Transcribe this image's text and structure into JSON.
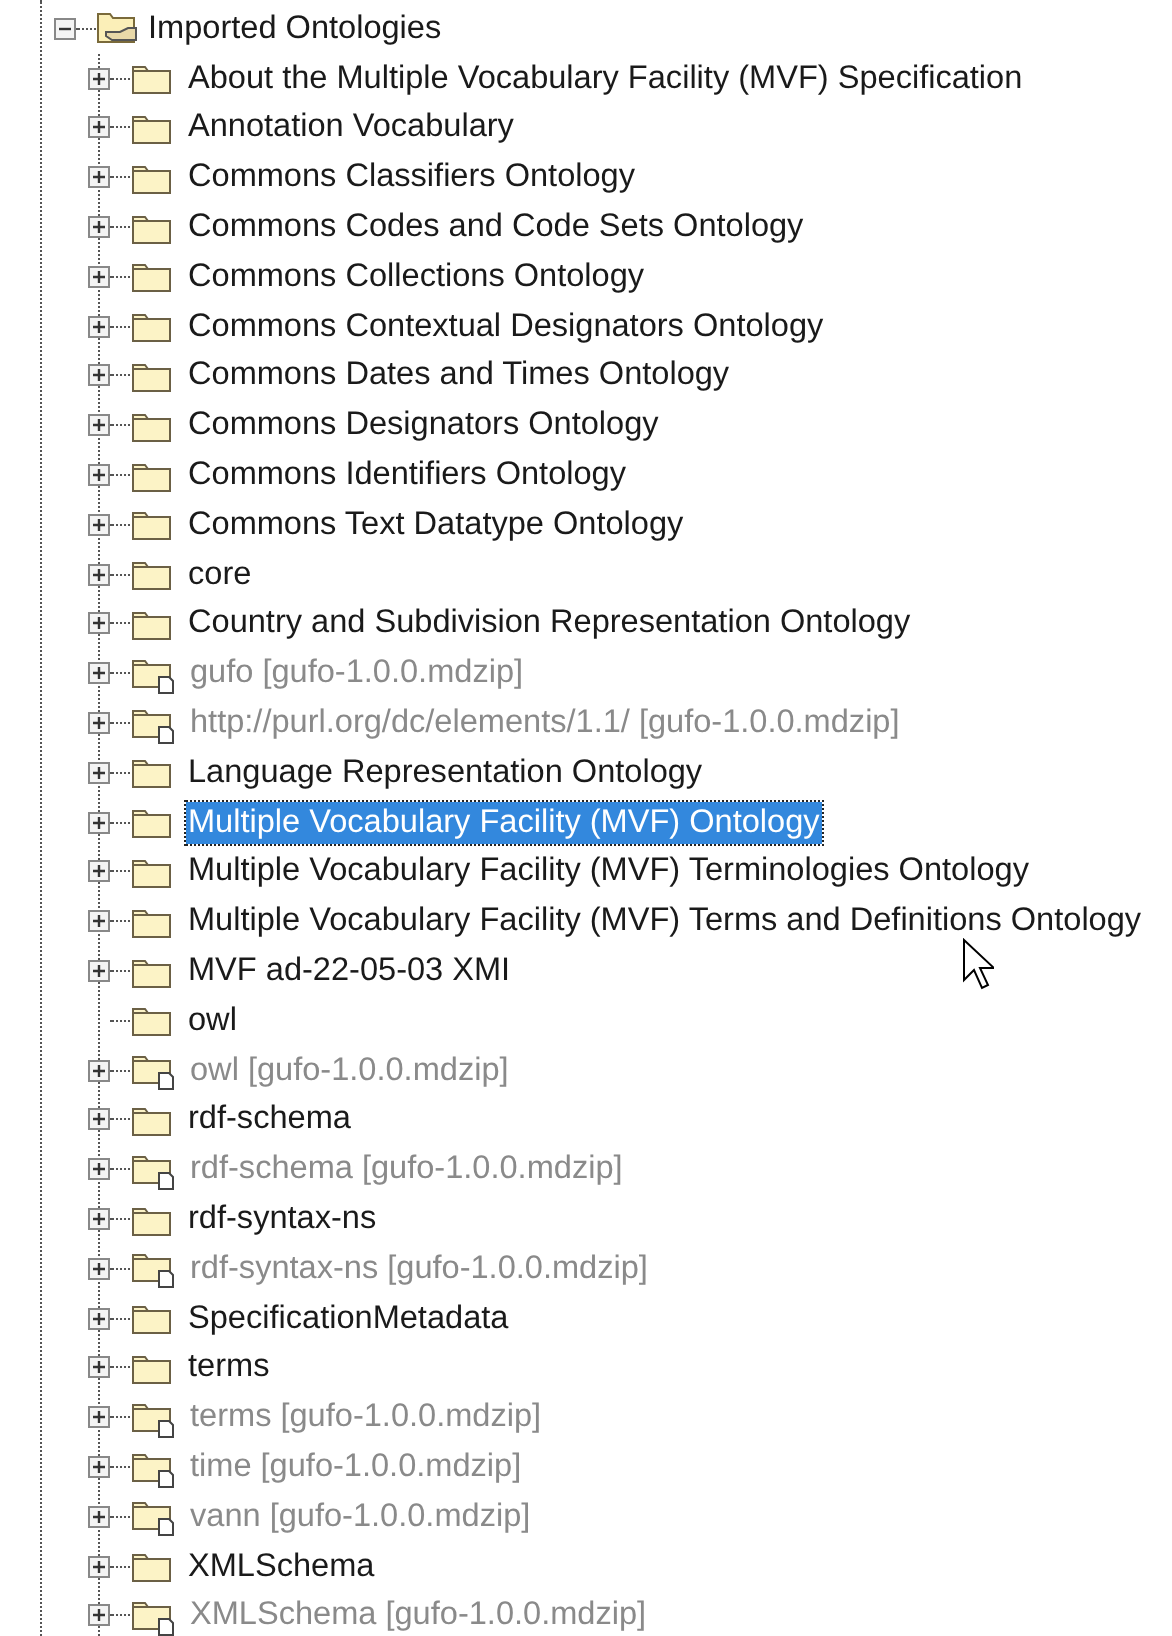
{
  "tree": {
    "root": {
      "label": "Imported Ontologies",
      "expanded": true,
      "children": [
        {
          "label": "About the Multiple Vocabulary Facility (MVF) Specification",
          "kind": "package",
          "expandable": true,
          "selected": false
        },
        {
          "label": "Annotation Vocabulary",
          "kind": "package",
          "expandable": true,
          "selected": false
        },
        {
          "label": "Commons Classifiers Ontology",
          "kind": "package",
          "expandable": true,
          "selected": false
        },
        {
          "label": "Commons Codes and Code Sets Ontology",
          "kind": "package",
          "expandable": true,
          "selected": false
        },
        {
          "label": "Commons Collections Ontology",
          "kind": "package",
          "expandable": true,
          "selected": false
        },
        {
          "label": "Commons Contextual Designators Ontology",
          "kind": "package",
          "expandable": true,
          "selected": false
        },
        {
          "label": "Commons Dates and Times Ontology",
          "kind": "package",
          "expandable": true,
          "selected": false
        },
        {
          "label": "Commons Designators Ontology",
          "kind": "package",
          "expandable": true,
          "selected": false
        },
        {
          "label": "Commons Identifiers Ontology",
          "kind": "package",
          "expandable": true,
          "selected": false
        },
        {
          "label": "Commons Text Datatype Ontology",
          "kind": "package",
          "expandable": true,
          "selected": false
        },
        {
          "label": "core",
          "kind": "package",
          "expandable": true,
          "selected": false
        },
        {
          "label": "Country and Subdivision Representation Ontology",
          "kind": "package",
          "expandable": true,
          "selected": false
        },
        {
          "label": "gufo [gufo-1.0.0.mdzip]",
          "kind": "linked",
          "expandable": true,
          "selected": false
        },
        {
          "label": "http://purl.org/dc/elements/1.1/ [gufo-1.0.0.mdzip]",
          "kind": "linked",
          "expandable": true,
          "selected": false
        },
        {
          "label": "Language Representation Ontology",
          "kind": "package",
          "expandable": true,
          "selected": false
        },
        {
          "label": "Multiple Vocabulary Facility (MVF) Ontology",
          "kind": "package",
          "expandable": true,
          "selected": true
        },
        {
          "label": "Multiple Vocabulary Facility (MVF) Terminologies Ontology",
          "kind": "package",
          "expandable": true,
          "selected": false
        },
        {
          "label": "Multiple Vocabulary Facility (MVF) Terms and Definitions Ontology",
          "kind": "package",
          "expandable": true,
          "selected": false
        },
        {
          "label": "MVF ad-22-05-03 XMI",
          "kind": "package",
          "expandable": true,
          "selected": false
        },
        {
          "label": "owl",
          "kind": "package",
          "expandable": false,
          "selected": false
        },
        {
          "label": "owl [gufo-1.0.0.mdzip]",
          "kind": "linked",
          "expandable": true,
          "selected": false
        },
        {
          "label": "rdf-schema",
          "kind": "package",
          "expandable": true,
          "selected": false
        },
        {
          "label": "rdf-schema [gufo-1.0.0.mdzip]",
          "kind": "linked",
          "expandable": true,
          "selected": false
        },
        {
          "label": "rdf-syntax-ns",
          "kind": "package",
          "expandable": true,
          "selected": false
        },
        {
          "label": "rdf-syntax-ns [gufo-1.0.0.mdzip]",
          "kind": "linked",
          "expandable": true,
          "selected": false
        },
        {
          "label": "SpecificationMetadata",
          "kind": "package",
          "expandable": true,
          "selected": false
        },
        {
          "label": "terms",
          "kind": "package",
          "expandable": true,
          "selected": false
        },
        {
          "label": "terms [gufo-1.0.0.mdzip]",
          "kind": "linked",
          "expandable": true,
          "selected": false
        },
        {
          "label": "time [gufo-1.0.0.mdzip]",
          "kind": "linked",
          "expandable": true,
          "selected": false
        },
        {
          "label": "vann [gufo-1.0.0.mdzip]",
          "kind": "linked",
          "expandable": true,
          "selected": false
        },
        {
          "label": "XMLSchema",
          "kind": "package",
          "expandable": true,
          "selected": false
        },
        {
          "label": "XMLSchema [gufo-1.0.0.mdzip]",
          "kind": "linked",
          "expandable": true,
          "selected": false
        }
      ]
    }
  }
}
